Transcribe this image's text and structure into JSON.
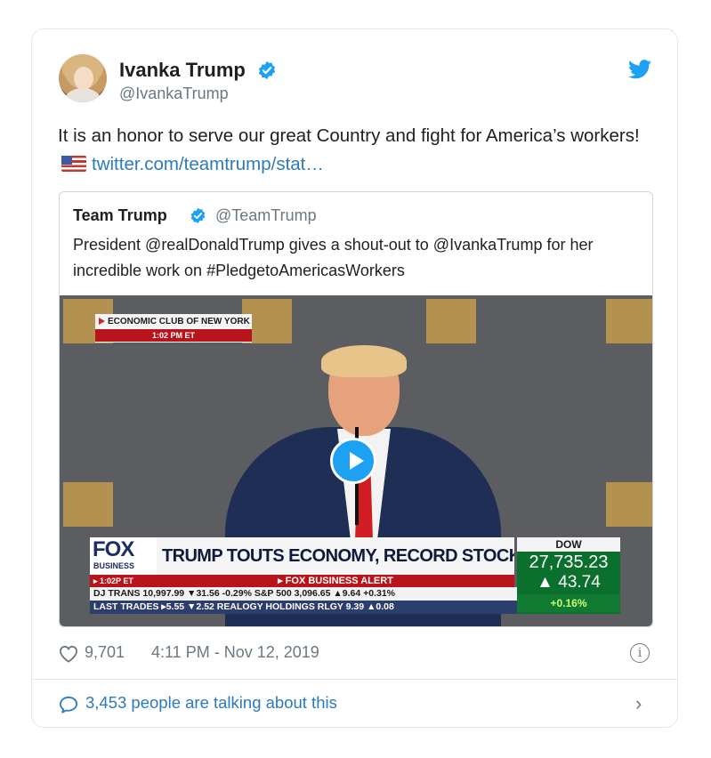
{
  "tweet": {
    "author_name": "Ivanka Trump",
    "author_handle": "@IvankaTrump",
    "text": "It is an honor to serve our great Country and fight for America’s workers!",
    "link_text": "twitter.com/teamtrump/stat…",
    "likes": "9,701",
    "timestamp": "4:11 PM - Nov 12, 2019",
    "talking_text": "3,453 people are talking about this"
  },
  "quoted": {
    "author_name": "Team Trump",
    "author_handle": "@TeamTrump",
    "text": "President @realDonaldTrump gives a shout-out to @IvankaTrump for her incredible work on #PledgetoAmericasWorkers"
  },
  "video": {
    "location_label": "ECONOMIC CLUB OF NEW YORK",
    "location_time": "1:02 PM ET",
    "network": "FOX",
    "network_sub": "BUSINESS",
    "headline": "TRUMP TOUTS ECONOMY, RECORD STOCK MARKET",
    "time_tag": "▸ 1:02P ET",
    "alert": "▸ FOX BUSINESS ALERT",
    "ticker_line1": "DJ TRANS 10,997.99 ▼31.56 -0.29% S&P 500 3,096.65 ▲9.64 +0.31%",
    "ticker_line2": "LAST TRADES ▸5.55 ▼2.52 REALOGY HOLDINGS RLGY 9.39 ▲0.08",
    "dow_label": "DOW",
    "dow_value": "27,735.23",
    "dow_change": "▲ 43.74",
    "dow_pct": "+0.16%"
  },
  "colors": {
    "accent": "#1da1f2",
    "link": "#2b7bb9",
    "muted": "#697882"
  },
  "icons": [
    "verified-badge-icon",
    "twitter-bird-icon",
    "flag-icon",
    "play-icon",
    "heart-icon",
    "info-icon",
    "comment-bubble-icon",
    "chevron-right-icon"
  ]
}
